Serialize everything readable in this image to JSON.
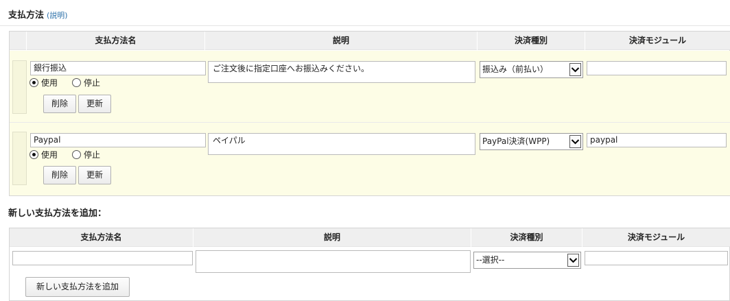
{
  "section": {
    "title": "支払方法",
    "help_link": "(説明)"
  },
  "table": {
    "headers": [
      "支払方法名",
      "説明",
      "決済種別",
      "決済モジュール"
    ],
    "rows": [
      {
        "name": "銀行振込",
        "description": "ご注文後に指定口座へお振込みください。",
        "payment_type": "振込み（前払い）",
        "module": "",
        "radio_use": "使用",
        "radio_stop": "停止",
        "selected": "使用",
        "delete_label": "削除",
        "update_label": "更新"
      },
      {
        "name": "Paypal",
        "description": "ペイパル",
        "payment_type": "PayPal決済(WPP)",
        "module": "paypal",
        "radio_use": "使用",
        "radio_stop": "停止",
        "selected": "使用",
        "delete_label": "削除",
        "update_label": "更新"
      }
    ]
  },
  "add_section": {
    "title": "新しい支払方法を追加：",
    "headers": [
      "支払方法名",
      "説明",
      "決済種別",
      "決済モジュール"
    ],
    "name_value": "",
    "description_value": "",
    "payment_type_selected": "--選択--",
    "module_value": "",
    "add_button_label": "新しい支払方法を追加"
  },
  "colors": {
    "header_bg": "#efefef",
    "row_bg": "#fdfde6",
    "link": "#2a6fa8"
  },
  "icons": {
    "select_arrow": "chevron-down-icon",
    "radio": "radio-icon"
  }
}
